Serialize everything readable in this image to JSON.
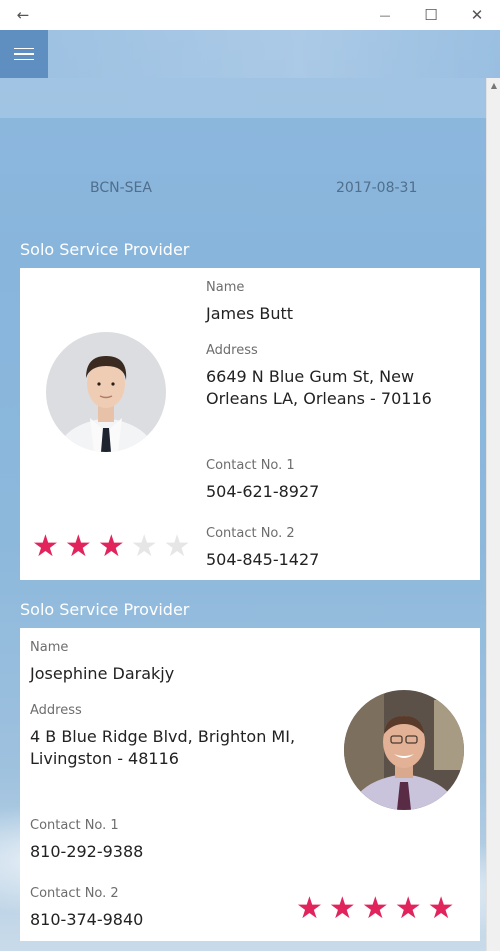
{
  "window": {
    "back_glyph": "←",
    "minimize_glyph": "—",
    "maximize_glyph": "☐",
    "close_glyph": "✕"
  },
  "trip": {
    "route": "BCN-SEA",
    "date": "2017-08-31"
  },
  "providers": [
    {
      "section_title": "Solo Service Provider",
      "name_label": "Name",
      "name": "James Butt",
      "address_label": "Address",
      "address": "6649 N Blue Gum St, New Orleans LA, Orleans - 70116",
      "contact1_label": "Contact No. 1",
      "contact1": "504-621-8927",
      "contact2_label": "Contact No. 2",
      "contact2": "504-845-1427",
      "rating": 3,
      "rating_max": 5
    },
    {
      "section_title": "Solo Service Provider",
      "name_label": "Name",
      "name": "Josephine Darakjy",
      "address_label": "Address",
      "address": "4 B Blue Ridge Blvd, Brighton MI, Livingston - 48116",
      "contact1_label": "Contact No. 1",
      "contact1": "810-292-9388",
      "contact2_label": "Contact No. 2",
      "contact2": "810-374-9840",
      "rating": 5,
      "rating_max": 5
    }
  ],
  "colors": {
    "star_on": "#e2245d",
    "star_off": "#e6e6e6",
    "menu_button": "#5f8fc0"
  },
  "icons": {
    "back": "back-arrow-icon",
    "menu": "hamburger-menu-icon",
    "star": "star-icon"
  }
}
